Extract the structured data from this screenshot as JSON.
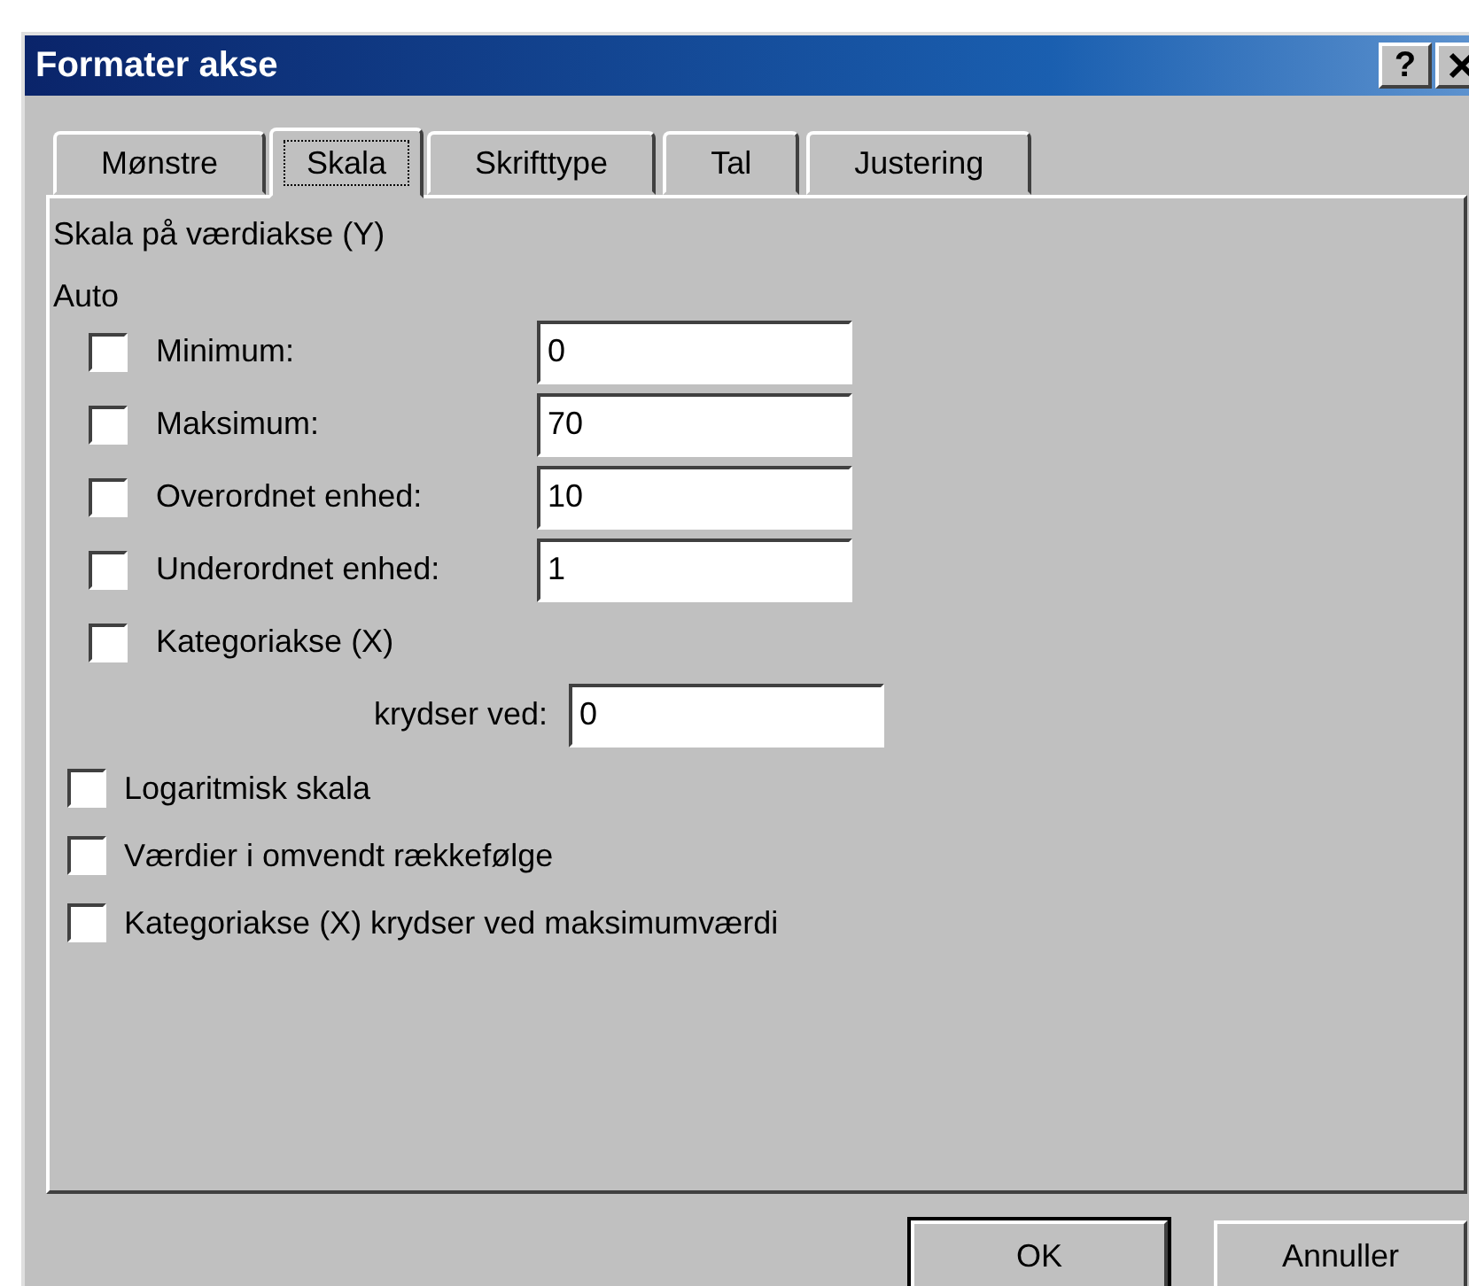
{
  "window": {
    "title": "Formater akse",
    "help_button": "?"
  },
  "tabs": [
    {
      "label": "Mønstre",
      "selected": false
    },
    {
      "label": "Skala",
      "selected": true
    },
    {
      "label": "Skrifttype",
      "selected": false
    },
    {
      "label": "Tal",
      "selected": false
    },
    {
      "label": "Justering",
      "selected": false
    }
  ],
  "panel": {
    "heading": "Skala på værdiakse (Y)",
    "auto_label": "Auto",
    "auto_rows": [
      {
        "kind": "checkbox-field",
        "label": "Minimum:",
        "checked": false,
        "value": "0"
      },
      {
        "kind": "checkbox-field",
        "label": "Maksimum:",
        "checked": false,
        "value": "70"
      },
      {
        "kind": "checkbox-field",
        "label": "Overordnet enhed:",
        "checked": false,
        "value": "10"
      },
      {
        "kind": "checkbox-field",
        "label": "Underordnet enhed:",
        "checked": false,
        "value": "1"
      },
      {
        "kind": "checkbox",
        "label": "Kategoriakse (X)",
        "checked": false
      },
      {
        "kind": "field",
        "label": "krydser ved:",
        "value": "0"
      }
    ],
    "options": [
      {
        "label": "Logaritmisk skala",
        "checked": false
      },
      {
        "label": "Værdier i omvendt rækkefølge",
        "checked": false
      },
      {
        "label": "Kategoriakse (X) krydser ved maksimumværdi",
        "checked": false
      }
    ]
  },
  "buttons": [
    {
      "label": "OK",
      "default": true
    },
    {
      "label": "Annuller",
      "default": false
    }
  ]
}
